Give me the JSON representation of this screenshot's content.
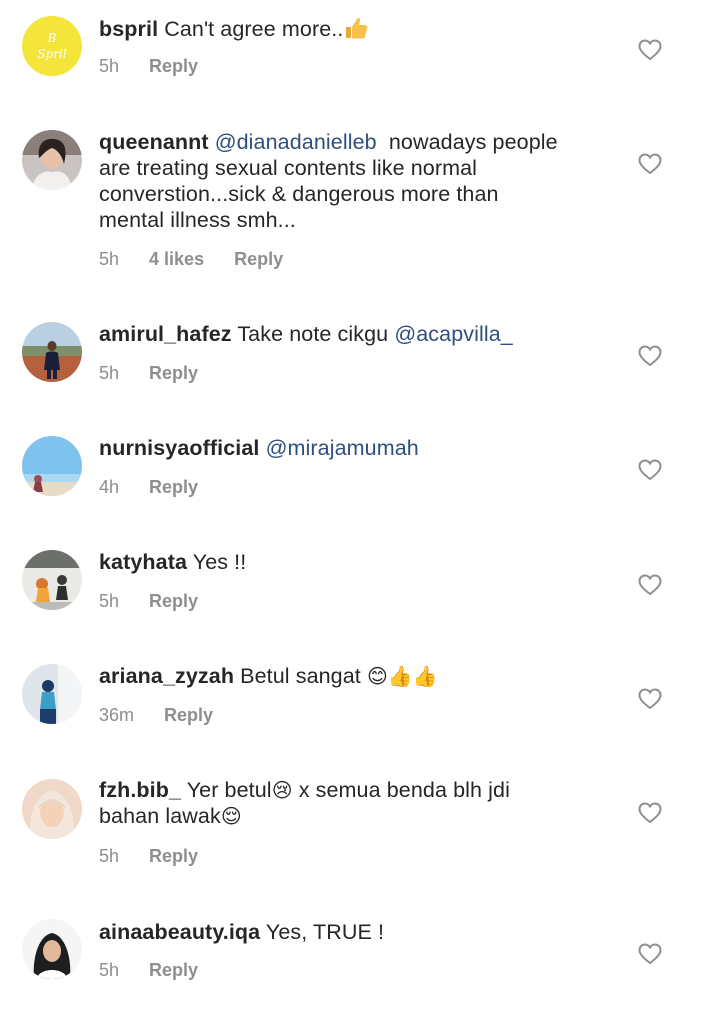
{
  "comments": [
    {
      "username": "bspril",
      "text": "Can't agree more..",
      "emoji": "👍",
      "time": "5h",
      "reply": "Reply",
      "avatar_text": [
        "B",
        "Spril"
      ]
    },
    {
      "username": "queenannt",
      "mention": "@dianadanielleb",
      "text_line1": "nowadays people",
      "text_rest": [
        "are treating sexual contents like normal",
        "converstion...sick & dangerous more than",
        "mental illness smh..."
      ],
      "time": "5h",
      "likes": "4 likes",
      "reply": "Reply"
    },
    {
      "username": "amirul_hafez",
      "text": "Take note cikgu",
      "mention": "@acapvilla_",
      "time": "5h",
      "reply": "Reply"
    },
    {
      "username": "nurnisyaofficial",
      "mention": "@mirajamumah",
      "time": "4h",
      "reply": "Reply"
    },
    {
      "username": "katyhata",
      "text": "Yes !!",
      "time": "5h",
      "reply": "Reply"
    },
    {
      "username": "ariana_zyzah",
      "text": "Betul sangat",
      "emoji": "😊👍👍",
      "time": "36m",
      "reply": "Reply"
    },
    {
      "username": "fzh.bib_",
      "text_a": "Yer betul",
      "emoji_a": "😢",
      "text_b": "x semua benda blh jdi",
      "text_c": "bahan lawak",
      "emoji_c": "😌",
      "time": "5h",
      "reply": "Reply"
    },
    {
      "username": "ainaabeauty.iqa",
      "text": "Yes, TRUE !",
      "time": "5h",
      "reply": "Reply"
    }
  ],
  "colors": {
    "text": "#262626",
    "meta": "#8e8e8e",
    "mention": "#2f4f7c",
    "heart": "#8e8e8e"
  },
  "icons": {
    "heart": "heart-outline-icon",
    "thumbs_up": "thumbs-up-emoji"
  }
}
